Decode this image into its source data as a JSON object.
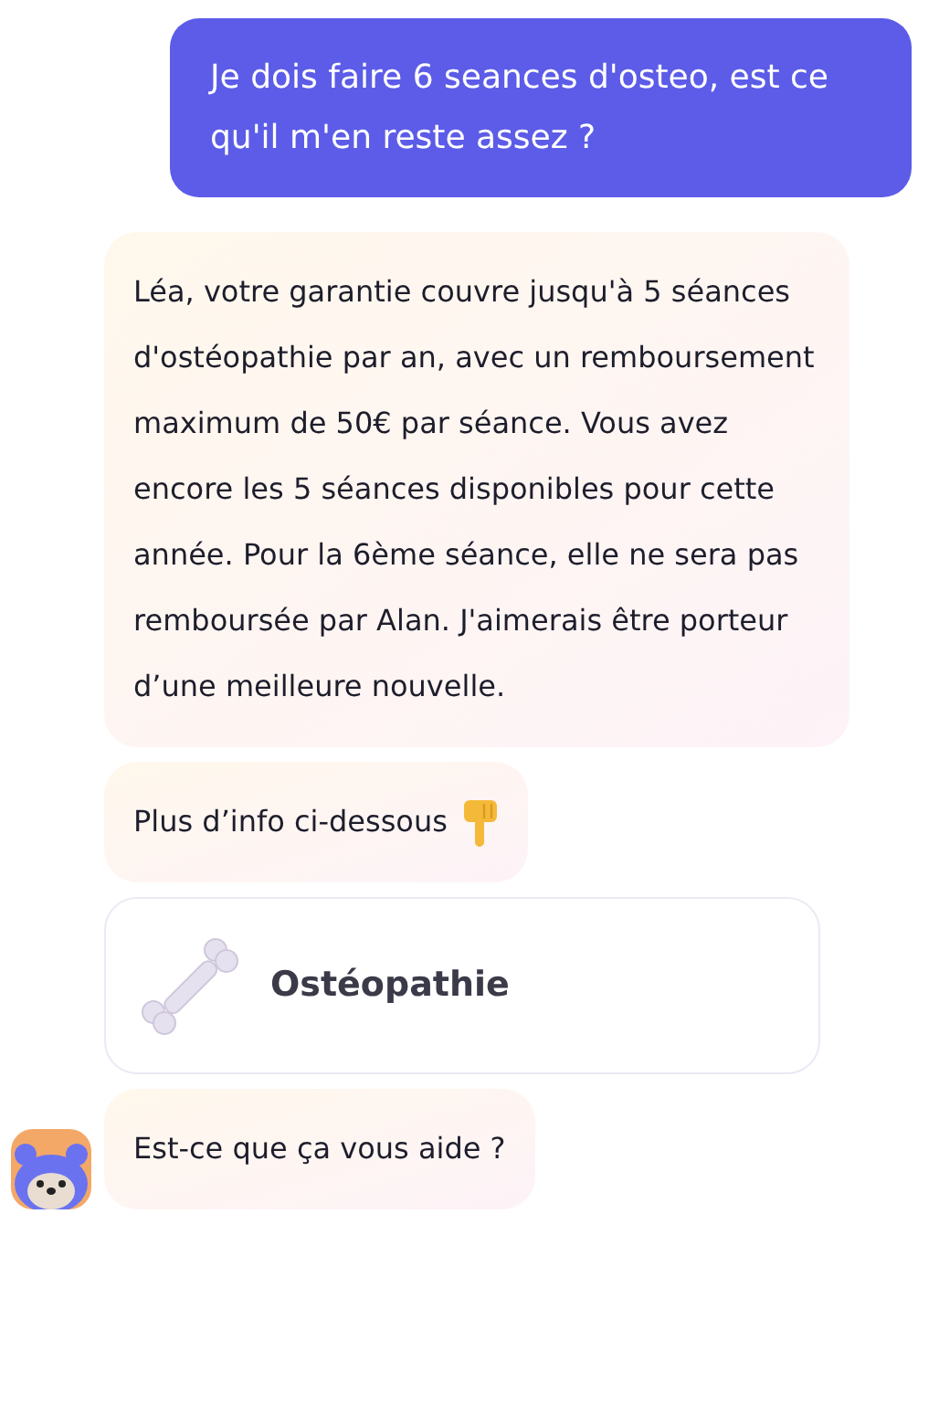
{
  "messages": [
    {
      "kind": "user",
      "text": "Je dois faire 6 seances d'osteo, est ce qu'il m'en reste assez ?"
    },
    {
      "kind": "bot",
      "text": "Léa, votre garantie couvre jusqu'à 5 séances d'ostéopathie par an, avec un remboursement maximum de 50€ par séance. Vous avez encore les 5 séances disponibles pour cette année. Pour la 6ème séance, elle ne sera pas remboursée par Alan. J'aimerais être porteur d’une meilleure nouvelle.",
      "avatar": false
    },
    {
      "kind": "bot",
      "text": "Plus d’info ci-dessous",
      "avatar": false
    },
    {
      "kind": "card",
      "text": "Ostéopathie"
    },
    {
      "kind": "bot",
      "text": "Est-ce que ça vous aide ?",
      "avatar": true
    }
  ]
}
